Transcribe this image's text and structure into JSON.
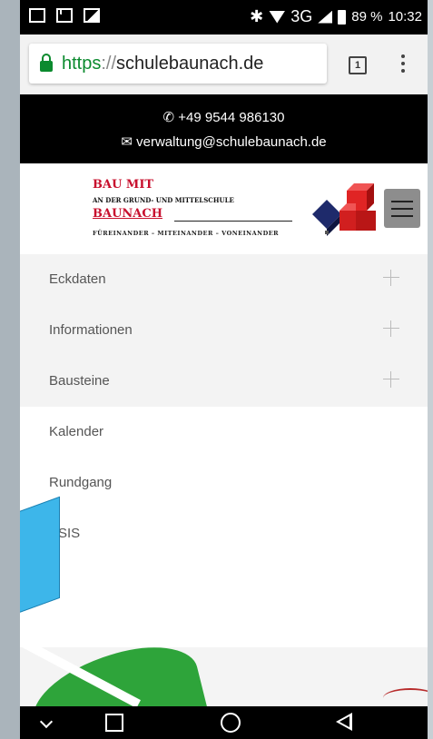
{
  "statusbar": {
    "network": "3G",
    "battery": "89 %",
    "time": "10:32"
  },
  "browser": {
    "url_scheme": "https",
    "url_separator": "://",
    "url_host": "schulebaunach.de",
    "tab_count": "1"
  },
  "contact": {
    "phone": "+49 9544 986130",
    "email": "verwaltung@schulebaunach.de"
  },
  "logo": {
    "line1": "BAU MIT",
    "line2": "AN DER GRUND- UND MITTELSCHULE",
    "line3": "BAUNACH",
    "line4": "FÜREINANDER – MITEINANDER – VONEINANDER"
  },
  "nav": {
    "items": [
      {
        "label": "Eckdaten",
        "expandable": true
      },
      {
        "label": "Informationen",
        "expandable": true
      },
      {
        "label": "Bausteine",
        "expandable": true
      },
      {
        "label": "Kalender",
        "expandable": false
      },
      {
        "label": "Rundgang",
        "expandable": false
      },
      {
        "label": "ESIS",
        "expandable": false
      }
    ]
  },
  "colors": {
    "accent_red": "#c8102e",
    "secure_green": "#0b8a2e",
    "callout_blue": "#3db6ea"
  },
  "icons": [
    "image-icon",
    "gmail-icon",
    "photo-icon",
    "bluetooth-icon",
    "wifi-icon",
    "signal-icon",
    "battery-icon",
    "lock-icon",
    "tabs-icon",
    "kebab-menu-icon",
    "phone-icon",
    "envelope-icon",
    "hamburger-icon",
    "plus-icon",
    "chevron-down-icon",
    "home-icon",
    "recents-icon",
    "back-icon"
  ]
}
